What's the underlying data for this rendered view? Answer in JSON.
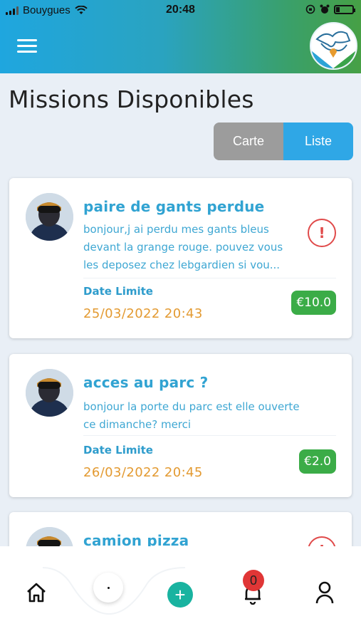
{
  "status_bar": {
    "carrier": "Bouygues",
    "time": "20:48"
  },
  "header": {
    "menu_icon": "hamburger-menu-icon",
    "logo": "app-logo"
  },
  "page": {
    "title": "Missions Disponibles"
  },
  "view_toggle": {
    "options": [
      "Carte",
      "Liste"
    ],
    "selected": "Liste"
  },
  "missions": [
    {
      "title": "paire de gants perdue",
      "description_lines": [
        "bonjour,j ai perdu mes gants bleus",
        "devant la grange rouge. pouvez vous",
        "les deposez chez lebgardien si vou..."
      ],
      "deadline_label": "Date Limite",
      "deadline": "25/03/2022 20:43",
      "price": "€10.0",
      "urgent": true
    },
    {
      "title": "acces au parc ?",
      "description_lines": [
        "bonjour la porte du parc est elle ouverte",
        "ce dimanche? merci"
      ],
      "deadline_label": "Date Limite",
      "deadline": "26/03/2022 20:45",
      "price": "€2.0",
      "urgent": false
    },
    {
      "title": "camion pizza",
      "urgent": true
    }
  ],
  "bottom_nav": {
    "items": [
      "home-icon",
      "dot-button",
      "plus-icon",
      "bell-icon",
      "user-icon"
    ],
    "notification_count": "0",
    "colors": {
      "fab": "#19b3a0",
      "badge": "#e03636"
    }
  },
  "colors": {
    "accent_blue": "#2fa7e6",
    "title_blue": "#31a3d2",
    "date_orange": "#e39a31",
    "price_green": "#3bac47",
    "alert_red": "#e04a4a"
  }
}
